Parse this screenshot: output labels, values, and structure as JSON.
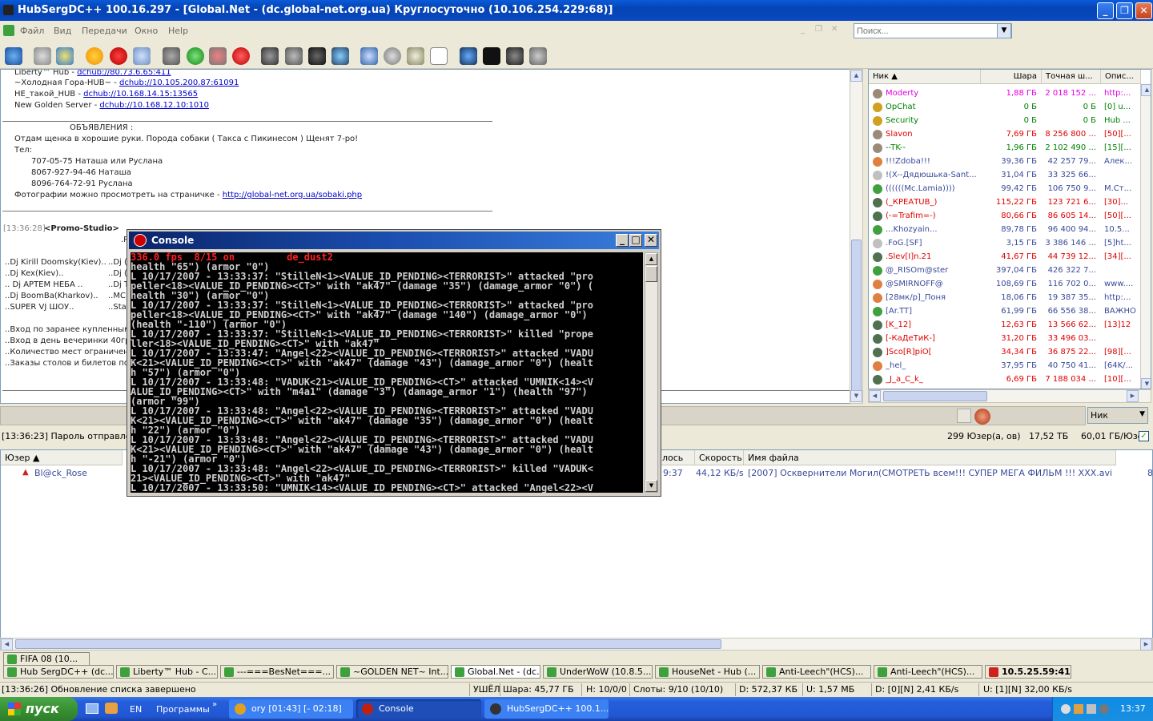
{
  "window": {
    "title": "HubSergDC++ 100.16.297 - [Global.Net - (dc.global-net.org.ua) Круглосуточно (10.106.254.229:68)]"
  },
  "menu": [
    "Файл",
    "Вид",
    "Передачи",
    "Окно",
    "Help"
  ],
  "search": {
    "placeholder": "Поиск..."
  },
  "chat": {
    "lines": [
      {
        "text": "Liberty™ Hub - ",
        "link": "dchub://80.73.6.65:411"
      },
      {
        "text": "~Холодная Гора-HUB~ - ",
        "link": "dchub://10.105.200.87:61091"
      },
      {
        "text": "НЕ_такой_HUB - ",
        "link": "dchub://10.168.14.15:13565"
      },
      {
        "text": "New Golden Server - ",
        "link": "dchub://10.168.12.10:1010"
      }
    ],
    "announce_title": "ОБЪЯВЛЕНИЯ :",
    "announce": [
      "Отдам щенка в хорошие руки. Порода собаки ( Такса с Пикинесом ) Щенят 7-ро!",
      "Тел:",
      "707-05-75  Наташа или Руслана",
      "8067-927-94-46  Наташа",
      "8096-764-72-91  Руслана"
    ],
    "photo_text": "Фотографии можно просмотреть на страничке - ",
    "photo_link": "http://global-net.org.ua/sobaki.php",
    "promo_time": "[13:36:28]",
    "promo_nick": "<Promo-Studio>",
    "promo_r": ".R",
    "djs": [
      "..Dj Kirill Doomsky(Kiev)..",
      "..Dj Kex(Kiev)..",
      ".. Dj АРТЕМ НЕБА ..",
      "..Dj BoomBa(Kharkov)..",
      "..SUPER VJ ШОУ.."
    ],
    "djs_right": [
      "..Dj (",
      "..Dj (",
      "..Dj T",
      "..MC",
      "..Star"
    ],
    "info": [
      "..Вход по заранее купленным б",
      "..Вход в день вечеринки 40грн",
      "..Количество мест ограничено",
      "..Заказы столов и билетов по"
    ]
  },
  "status_line": "[13:36:23] Пароль отправлен...",
  "hub_stats": {
    "users": "299 Юзер(а, ов)",
    "share": "17,52 ТБ",
    "per_user": "60,01 ГБ/Юзер"
  },
  "nick_select": "Ник",
  "userlist": {
    "headers": [
      "Ник",
      "Шара",
      "Точная ш...",
      "Опис..."
    ],
    "users": [
      {
        "nick": "Moderty",
        "share": "1,88 ГБ",
        "exact": "2 018 152 ...",
        "desc": "http:...",
        "color": "#e000e0",
        "icon": "#9a8a7a"
      },
      {
        "nick": "OpChat",
        "share": "0 Б",
        "exact": "0 Б",
        "desc": "[0] u...",
        "color": "#008000",
        "icon": "#d0a020"
      },
      {
        "nick": "Security",
        "share": "0 Б",
        "exact": "0 Б",
        "desc": "Hub ...",
        "color": "#008000",
        "icon": "#d0a020"
      },
      {
        "nick": "Slavon",
        "share": "7,69 ГБ",
        "exact": "8 256 800 ...",
        "desc": "[50][...",
        "color": "#e00000",
        "icon": "#9a8a7a"
      },
      {
        "nick": "--TK--",
        "share": "1,96 ГБ",
        "exact": "2 102 490 ...",
        "desc": "[15][...",
        "color": "#008000",
        "icon": "#9a8a7a"
      },
      {
        "nick": "!!!Zdoba!!!",
        "share": "39,36 ГБ",
        "exact": "42 257 79...",
        "desc": "Алек...",
        "color": "#3a4a9a",
        "icon": "#e08040"
      },
      {
        "nick": "!(X--Дядюшька-Sant...",
        "share": "31,04 ГБ",
        "exact": "33 325 66...",
        "desc": "",
        "color": "#3a4a9a",
        "icon": "#c0c0c0"
      },
      {
        "nick": "((((((Mc.Lamia))))",
        "share": "99,42 ГБ",
        "exact": "106 750 9...",
        "desc": "M.Ст...",
        "color": "#3a4a9a",
        "icon": "#40a040"
      },
      {
        "nick": "(_КРЕАТUB_)",
        "share": "115,22 ГБ",
        "exact": "123 721 6...",
        "desc": "[30]...",
        "color": "#e00000",
        "icon": "#507050"
      },
      {
        "nick": "(-=Trafim=-)",
        "share": "80,66 ГБ",
        "exact": "86 605 14...",
        "desc": "[50][...",
        "color": "#e00000",
        "icon": "#507050"
      },
      {
        "nick": "...Khozyain...",
        "share": "89,78 ГБ",
        "exact": "96 400 94...",
        "desc": "10.5...",
        "color": "#3a4a9a",
        "icon": "#40a040"
      },
      {
        "nick": ".FoG.[SF]",
        "share": "3,15 ГБ",
        "exact": "3 386 146 ...",
        "desc": "[5]ht...",
        "color": "#3a4a9a",
        "icon": "#c0c0c0"
      },
      {
        "nick": ".Slev[I]n.21",
        "share": "41,67 ГБ",
        "exact": "44 739 12...",
        "desc": "[34][...",
        "color": "#e00000",
        "icon": "#507050"
      },
      {
        "nick": "@_RISOm@ster",
        "share": "397,04 ГБ",
        "exact": "426 322 7...",
        "desc": "",
        "color": "#3a4a9a",
        "icon": "#40a040"
      },
      {
        "nick": "@SMIRNOFF@",
        "share": "108,69 ГБ",
        "exact": "116 702 0...",
        "desc": "www....",
        "color": "#3a4a9a",
        "icon": "#e08040"
      },
      {
        "nick": "[28мк/р]_Поня",
        "share": "18,06 ГБ",
        "exact": "19 387 35...",
        "desc": "http:...",
        "color": "#3a4a9a",
        "icon": "#e08040"
      },
      {
        "nick": "[Ar.TT]",
        "share": "61,99 ГБ",
        "exact": "66 556 38...",
        "desc": "ВАЖНО",
        "color": "#3a4a9a",
        "icon": "#40a040"
      },
      {
        "nick": "[K_12]",
        "share": "12,63 ГБ",
        "exact": "13 566 62...",
        "desc": "[13]12",
        "color": "#e00000",
        "icon": "#507050"
      },
      {
        "nick": "[-КаДеТиК-]",
        "share": "31,20 ГБ",
        "exact": "33 496 03...",
        "desc": "",
        "color": "#e00000",
        "icon": "#507050"
      },
      {
        "nick": "]Sco[R]piO[",
        "share": "34,34 ГБ",
        "exact": "36 875 22...",
        "desc": "[98][...",
        "color": "#e00000",
        "icon": "#507050"
      },
      {
        "nick": "_hel_",
        "share": "37,95 ГБ",
        "exact": "40 750 41...",
        "desc": "[64K/...",
        "color": "#3a4a9a",
        "icon": "#e08040"
      },
      {
        "nick": "_J_a_C_k_",
        "share": "6,69 ГБ",
        "exact": "7 188 034 ...",
        "desc": "[10][...",
        "color": "#e00000",
        "icon": "#507050"
      }
    ]
  },
  "transfers": {
    "headers": [
      "Юзер",
      "",
      "",
      "",
      "",
      "",
      "",
      "",
      "",
      "лось",
      "Скорость",
      "Имя файла"
    ],
    "row": {
      "user": "Bl@ck_Rose",
      "elapsed": "9:37",
      "speed": "44,12 КБ/s",
      "file": "[2007] Осквернители Могил(СМОТРЕТЬ всем!!! СУПЕР МЕГА ФИЛЬМ !!! XXX.avi",
      "end": "8"
    }
  },
  "tabs_row1": [
    "FIFA 08    (10..."
  ],
  "tabs_row2": [
    "Hub SergDC++ (dc...",
    "Liberty™ Hub - C...",
    "---===BesNet===...",
    "~GOLDEN NET~ Int...",
    "Global.Net - (dc...",
    "UnderWoW (10.8.5...",
    "HouseNet - Hub (...",
    "Anti-Leech\"(HCS)...",
    "Anti-Leech\"(HCS)...",
    "10.5.25.59:411"
  ],
  "statusbar": {
    "msg": "[13:36:26] Обновление списка завершено",
    "away": "УШЁЛ",
    "share": "Шара: 45,77 ГБ",
    "hubs": "Н: 10/0/0",
    "slots": "Слоты: 9/10 (10/10)",
    "down": "D: 572,37 КБ",
    "up": "U: 1,57 МБ",
    "dspeed": "D: [0][N] 2,41 КБ/s",
    "uspeed": "U: [1][N] 32,00 КБ/s"
  },
  "console": {
    "title": "Console",
    "fps_line": "336.0 fps  8/15 on         de_dust2",
    "log": "health \"65\") (armor \"0\")\nL 10/17/2007 - 13:33:37: \"StilleN<1><VALUE_ID_PENDING><TERRORIST>\" attacked \"pro\npeller<18><VALUE_ID_PENDING><CT>\" with \"ak47\" (damage \"35\") (damage_armor \"0\") (\nhealth \"30\") (armor \"0\")\nL 10/17/2007 - 13:33:37: \"StilleN<1><VALUE_ID_PENDING><TERRORIST>\" attacked \"pro\npeller<18><VALUE_ID_PENDING><CT>\" with \"ak47\" (damage \"140\") (damage_armor \"0\")\n(health \"-110\") (armor \"0\")\nL 10/17/2007 - 13:33:37: \"StilleN<1><VALUE_ID_PENDING><TERRORIST>\" killed \"prope\nller<18><VALUE_ID_PENDING><CT>\" with \"ak47\"\nL 10/17/2007 - 13:33:47: \"Angel<22><VALUE_ID_PENDING><TERRORIST>\" attacked \"VADU\nK<21><VALUE_ID_PENDING><CT>\" with \"ak47\" (damage \"43\") (damage_armor \"0\") (healt\nh \"57\") (armor \"0\")\nL 10/17/2007 - 13:33:48: \"VADUK<21><VALUE_ID_PENDING><CT>\" attacked \"UMNIK<14><V\nALUE_ID_PENDING><CT>\" with \"m4a1\" (damage \"3\") (damage_armor \"1\") (health \"97\")\n(armor \"99\")\nL 10/17/2007 - 13:33:48: \"Angel<22><VALUE_ID_PENDING><TERRORIST>\" attacked \"VADU\nK<21><VALUE_ID_PENDING><CT>\" with \"ak47\" (damage \"35\") (damage_armor \"0\") (healt\nh \"22\") (armor \"0\")\nL 10/17/2007 - 13:33:48: \"Angel<22><VALUE_ID_PENDING><TERRORIST>\" attacked \"VADU\nK<21><VALUE_ID_PENDING><CT>\" with \"ak47\" (damage \"43\") (damage_armor \"0\") (healt\nh \"-21\") (armor \"0\")\nL 10/17/2007 - 13:33:48: \"Angel<22><VALUE_ID_PENDING><TERRORIST>\" killed \"VADUK<\n21><VALUE_ID_PENDING><CT>\" with \"ak47\"\nL 10/17/2007 - 13:33:50: \"UMNIK<14><VALUE_ID_PENDING><CT>\" attacked \"Angel<22><V"
  },
  "taskbar": {
    "start": "пуск",
    "lang": "EN",
    "programs": "Программы",
    "tasks": [
      "ory [01:43] [- 02:18]",
      "Console",
      "HubSergDC++ 100.1..."
    ],
    "time": "13:37"
  }
}
